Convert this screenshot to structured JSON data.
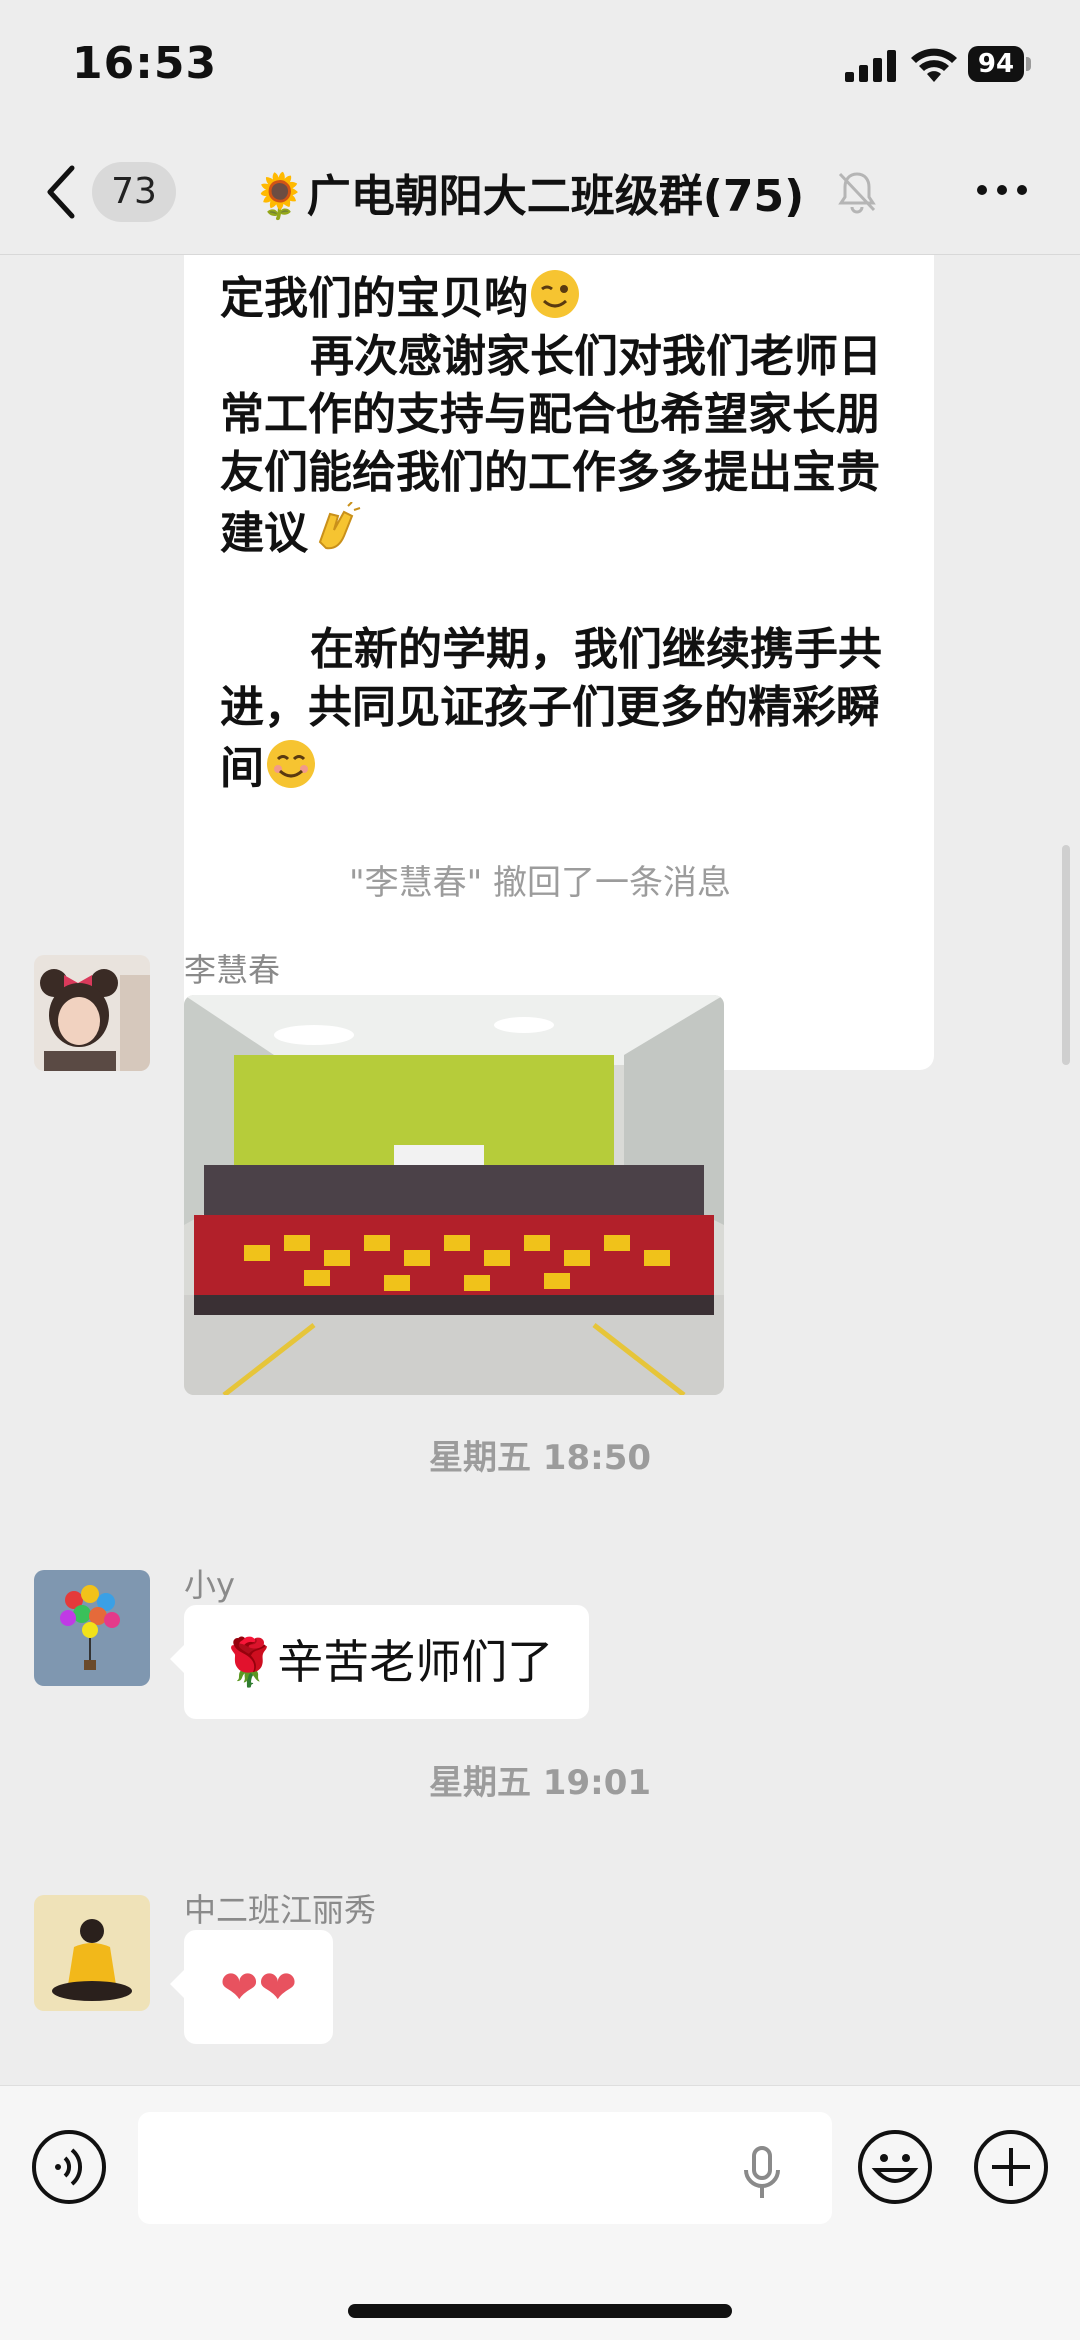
{
  "status_bar": {
    "time": "16:53",
    "battery": "94"
  },
  "nav": {
    "unread_count": "73",
    "title": "🌻广电朝阳大二班级群(75)"
  },
  "messages": {
    "announcement_lines": {
      "line1": "定我们的宝贝哟",
      "para2": "再次感谢家长们对我们老师日常工作的支持与配合也希望家长朋友们能给我们的工作多多提出宝贵建议",
      "para3": "在新的学期，我们继续携手共进，共同见证孩子们更多的精彩瞬间"
    },
    "recall_notice": "\"李慧春\" 撤回了一条消息",
    "photo_msg": {
      "sender": "李慧春"
    },
    "ts1": "星期五 18:50",
    "msg2": {
      "sender": "小y",
      "text": "🌹辛苦老师们了"
    },
    "ts2": "星期五 19:01",
    "msg3": {
      "sender": "中二班江丽秀",
      "text": "❤❤"
    }
  },
  "colors": {
    "background": "#ededed",
    "bubble": "#ffffff",
    "meta_text": "#9c9c9c",
    "heart": "#e8525f"
  }
}
